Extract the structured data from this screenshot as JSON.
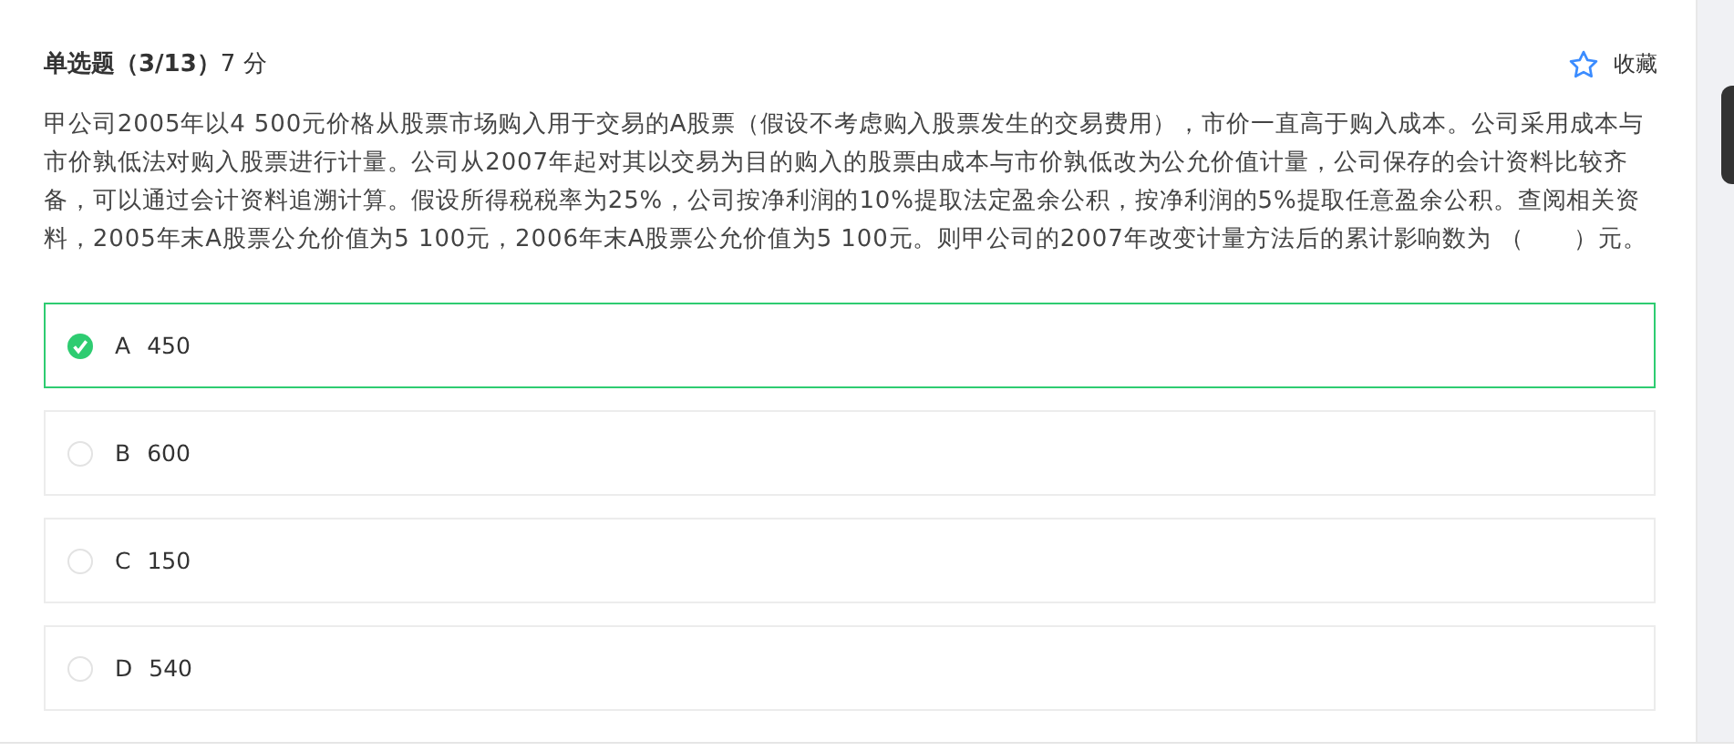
{
  "question": {
    "title": "**单选题（3/13）**7 分",
    "favorite": {
      "label": "收藏",
      "on": false
    },
    "text": "甲公司2005年以4 500元价格从股票市场购入用于交易的A股票（假设不考虑购入股票发生的交易费用），市价一直高于购入成本。公司采用成本与市价孰低法对购入股票进行计量。公司从2007年起对其以交易为目的购入的股票由成本与市价孰低改为公允价值计量，公司保存的会计资料比较齐备，可以通过会计资料追溯计算。假设所得税税率为25%，公司按净利润的10%提取法定盈余公积，按净利润的5%提取任意盈余公积。查阅相关资料，2005年末A股票公允价值为5 100元，2006年末A股票公允价值为5 100元。则甲公司的2007年改变计量方法后的累计影响数为 （　　）元。"
  },
  "options": [
    {
      "letter": "A",
      "text": "450",
      "selected": true
    },
    {
      "letter": "B",
      "text": "600",
      "selected": false
    },
    {
      "letter": "C",
      "text": "150",
      "selected": false
    },
    {
      "letter": "D",
      "text": "540",
      "selected": false
    }
  ]
}
